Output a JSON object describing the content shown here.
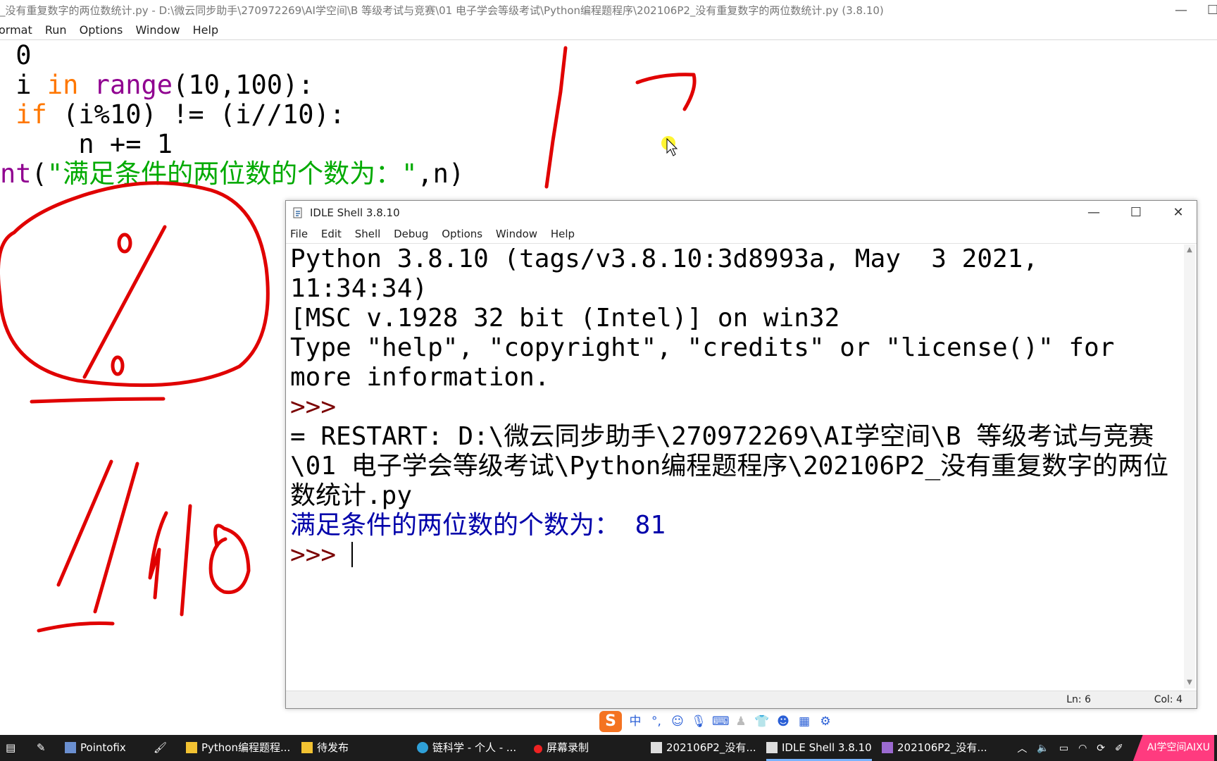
{
  "editor": {
    "title": "_没有重复数字的两位数统计.py - D:\\微云同步助手\\270972269\\AI学空间\\B 等级考试与竞赛\\01 电子学会等级考试\\Python编程题程序\\202106P2_没有重复数字的两位数统计.py (3.8.10)",
    "menu": [
      "ormat",
      "Run",
      "Options",
      "Window",
      "Help"
    ],
    "code": {
      "l1": " 0",
      "l2_a": " i ",
      "l2_kw": "in",
      "l2_sp": " ",
      "l2_bi": "range",
      "l2_rest": "(10,100):",
      "l3_sp": " ",
      "l3_kw": "if",
      "l3_rest": " (i%10) != (i//10):",
      "l4": "     n += 1",
      "l5_bi": "nt",
      "l5_p": "(",
      "l5_str": "\"满足条件的两位数的个数为：\"",
      "l5_rest": ",n)"
    }
  },
  "shell": {
    "title": "IDLE Shell 3.8.10",
    "menu": [
      "File",
      "Edit",
      "Shell",
      "Debug",
      "Options",
      "Window",
      "Help"
    ],
    "banner1": "Python 3.8.10 (tags/v3.8.10:3d8993a, May  3 2021, 11:34:34)",
    "banner2": "[MSC v.1928 32 bit (Intel)] on win32",
    "banner3": "Type \"help\", \"copyright\", \"credits\" or \"license()\" for more information.",
    "prompt": ">>> ",
    "restart": "= RESTART: D:\\微云同步助手\\270972269\\AI学空间\\B 等级考试与竞赛\\01 电子学会等级考试\\Python编程题程序\\202106P2_没有重复数字的两位数统计.py",
    "output": "满足条件的两位数的个数为： 81",
    "status_ln": "Ln: 6",
    "status_col": "Col: 4",
    "btn_min": "—",
    "btn_max": "☐",
    "btn_close": "✕"
  },
  "ime": {
    "logo": "S",
    "mode": "中",
    "punct": "°,"
  },
  "taskbar": {
    "items": [
      "Pointofix",
      "Python编程题程...",
      "待发布",
      "链科学 - 个人 - ...",
      "屏幕录制",
      "202106P2_没有...",
      "IDLE Shell 3.8.10",
      "202106P2_没有..."
    ],
    "tray_label": "AI学空间AIXU"
  },
  "colors": {
    "keyword": "#ff7700",
    "builtin": "#900090",
    "string": "#00aa00",
    "output": "#0000aa",
    "annotation": "#e00000"
  }
}
